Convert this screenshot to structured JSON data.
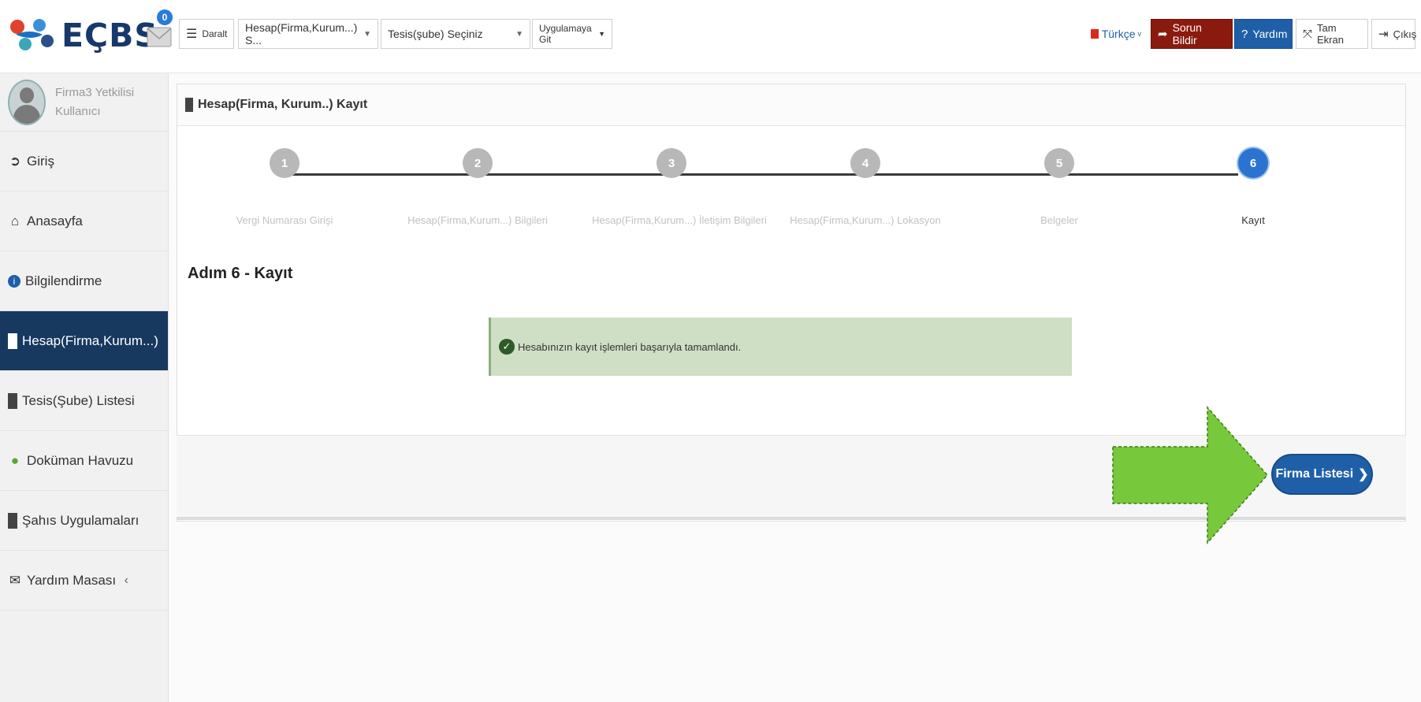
{
  "brand": {
    "name": "EÇBS"
  },
  "header": {
    "mail_badge": "0",
    "collapse_label": "Daralt",
    "account_select": "Hesap(Firma,Kurum...) S...",
    "facility_select": "Tesis(şube) Seçiniz",
    "app_go": "Uygulamaya Git",
    "language": "Türkçe",
    "report_issue": "Sorun Bildir",
    "help": "Yardım",
    "fullscreen": "Tam Ekran",
    "logout": "Çıkış"
  },
  "sidebar": {
    "user_name": "Firma3 Yetkilisi",
    "user_role": "Kullanıcı",
    "items": [
      {
        "label": "Giriş",
        "icon": "arrow-circle-right-icon"
      },
      {
        "label": "Anasayfa",
        "icon": "home-icon"
      },
      {
        "label": "Bilgilendirme",
        "icon": "info-icon"
      },
      {
        "label": "Hesap(Firma,Kurum...)",
        "icon": "building-icon",
        "active": true
      },
      {
        "label": "Tesis(Şube) Listesi",
        "icon": "building-icon"
      },
      {
        "label": "Doküman Havuzu",
        "icon": "users-icon"
      },
      {
        "label": "Şahıs Uygulamaları",
        "icon": "building-icon"
      },
      {
        "label": "Yardım Masası",
        "icon": "envelope-icon"
      }
    ]
  },
  "main": {
    "panel_title": "Hesap(Firma, Kurum..) Kayıt",
    "steps": [
      {
        "number": "1",
        "label": "Vergi Numarası Girişi"
      },
      {
        "number": "2",
        "label": "Hesap(Firma,Kurum...) Bilgileri"
      },
      {
        "number": "3",
        "label": "Hesap(Firma,Kurum...) İletişim Bilgileri"
      },
      {
        "number": "4",
        "label": "Hesap(Firma,Kurum...) Lokasyon"
      },
      {
        "number": "5",
        "label": "Belgeler"
      },
      {
        "number": "6",
        "label": "Kayıt",
        "active": true
      }
    ],
    "step_heading": "Adım 6 - Kayıt",
    "success_message": "Hesabınızın kayıt işlemleri başarıyla tamamlandı.",
    "firma_listesi_button": "Firma Listesi"
  },
  "colors": {
    "sidebar_active": "#17395f",
    "report_issue_bg": "#8b1a0e",
    "help_bg": "#1f5fa8",
    "step_active": "#2a73d1",
    "alert_bg": "#cfdfc5",
    "arrow": "#77c83a"
  }
}
